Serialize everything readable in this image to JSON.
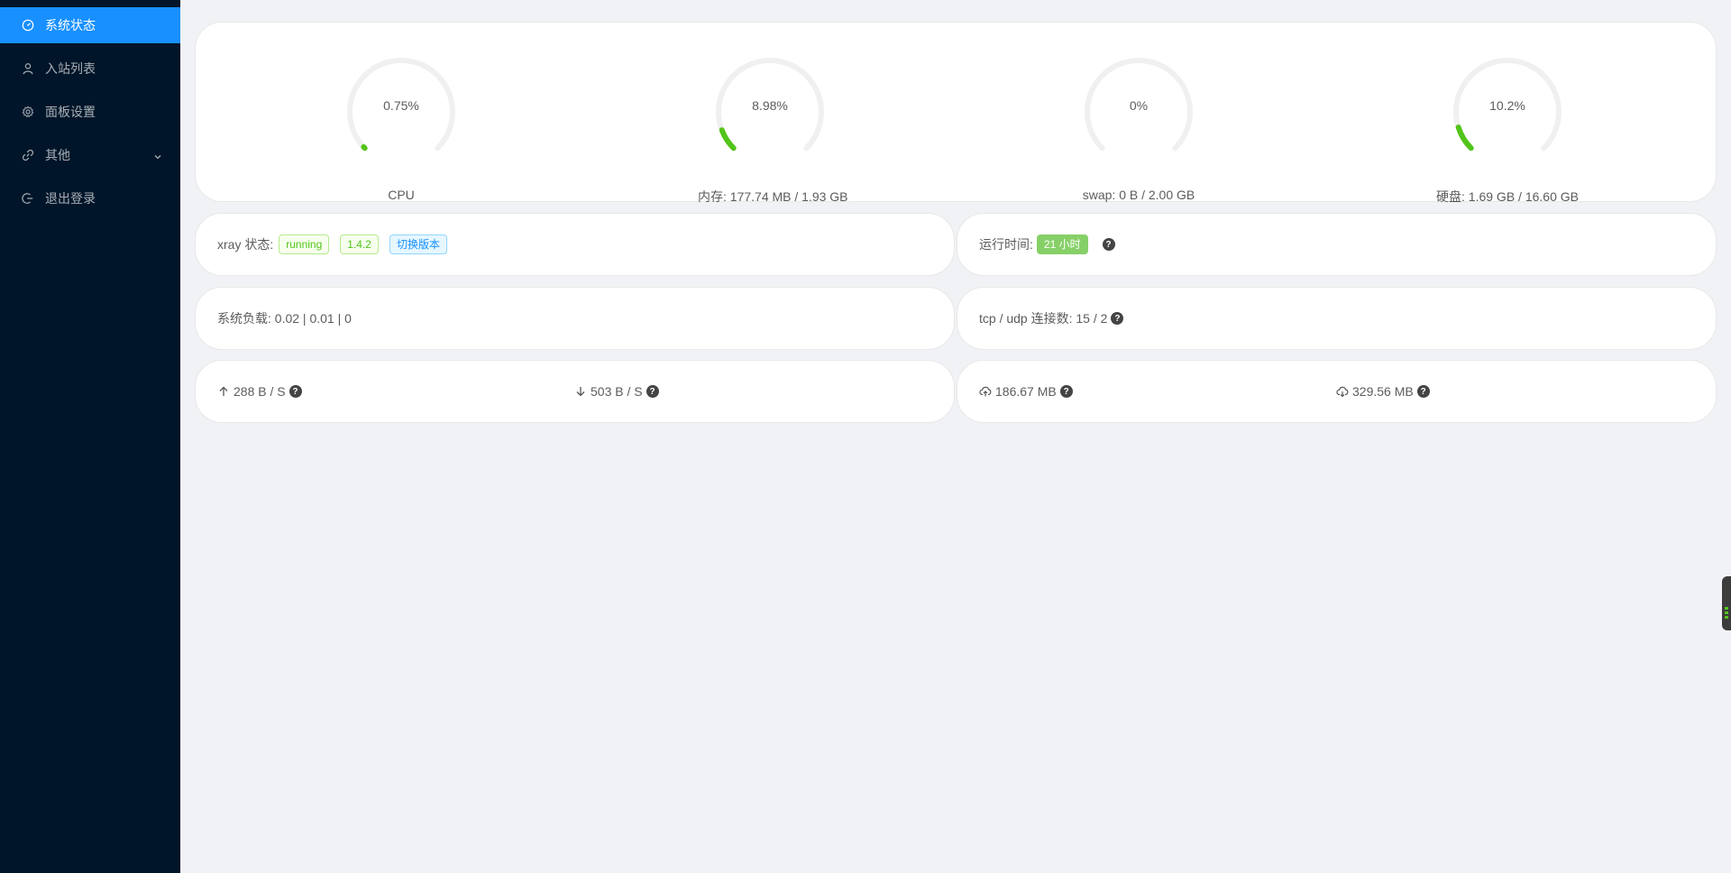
{
  "sidebar": {
    "items": [
      {
        "label": "系统状态",
        "icon": "dashboard-icon",
        "active": true
      },
      {
        "label": "入站列表",
        "icon": "user-icon",
        "active": false
      },
      {
        "label": "面板设置",
        "icon": "gear-icon",
        "active": false
      },
      {
        "label": "其他",
        "icon": "link-icon",
        "active": false,
        "has_submenu": true
      },
      {
        "label": "退出登录",
        "icon": "logout-icon",
        "active": false
      }
    ]
  },
  "gauges": [
    {
      "value_text": "0.75%",
      "percent": 0.75,
      "label": "CPU"
    },
    {
      "value_text": "8.98%",
      "percent": 8.98,
      "label": "内存: 177.74 MB / 1.93 GB"
    },
    {
      "value_text": "0%",
      "percent": 0,
      "label": "swap: 0 B / 2.00 GB"
    },
    {
      "value_text": "10.2%",
      "percent": 10.2,
      "label": "硬盘: 1.69 GB / 16.60 GB"
    }
  ],
  "xray": {
    "label": "xray 状态:",
    "status": "running",
    "version": "1.4.2",
    "switch_label": "切换版本"
  },
  "uptime": {
    "label": "运行时间:",
    "value": "21 小时"
  },
  "load": {
    "label": "系统负载: 0.02 | 0.01 | 0"
  },
  "connections": {
    "label": "tcp / udp 连接数: 15 / 2"
  },
  "speed": {
    "up": "288 B / S",
    "down": "503 B / S"
  },
  "traffic": {
    "sent": "186.67 MB",
    "received": "329.56 MB"
  },
  "colors": {
    "accent": "#1890ff",
    "sidebar": "#001529",
    "gauge_fill": "#52c41a",
    "gauge_track": "#f0f0f0"
  }
}
